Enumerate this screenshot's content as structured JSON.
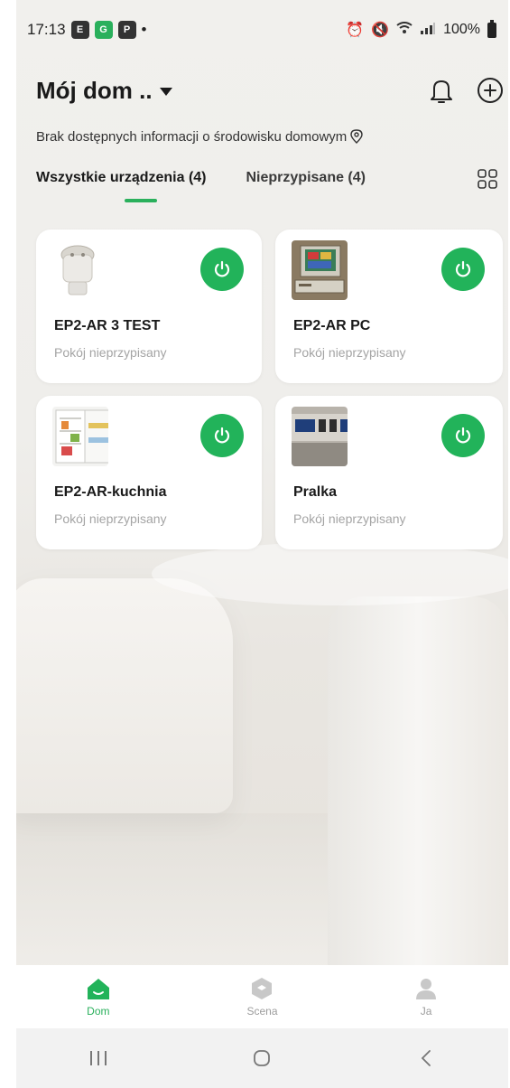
{
  "status_bar": {
    "time": "17:13",
    "battery": "100%",
    "notification_badges": [
      "E",
      "G",
      "P"
    ]
  },
  "header": {
    "home_name": "Mój dom ..",
    "environment_info": "Brak dostępnych informacji o środowisku domowym"
  },
  "tabs": [
    {
      "label": "Wszystkie urządzenia (4)",
      "active": true
    },
    {
      "label": "Nieprzypisane (4)",
      "active": false
    }
  ],
  "devices": [
    {
      "name": "EP2-AR 3 TEST",
      "room": "Pokój nieprzypisany",
      "icon": "smart-plug",
      "power_on": true
    },
    {
      "name": "EP2-AR PC",
      "room": "Pokój nieprzypisany",
      "icon": "computer",
      "power_on": true
    },
    {
      "name": "EP2-AR-kuchnia",
      "room": "Pokój nieprzypisany",
      "icon": "refrigerator",
      "power_on": true
    },
    {
      "name": "Pralka",
      "room": "Pokój nieprzypisany",
      "icon": "washing-machine-panel",
      "power_on": true
    }
  ],
  "bottom_nav": [
    {
      "label": "Dom",
      "icon": "home-icon",
      "active": true
    },
    {
      "label": "Scena",
      "icon": "scene-cube-icon",
      "active": false
    },
    {
      "label": "Ja",
      "icon": "person-icon",
      "active": false
    }
  ],
  "colors": {
    "accent": "#22b35a",
    "card": "#ffffff",
    "muted_text": "#a4a4a4"
  }
}
